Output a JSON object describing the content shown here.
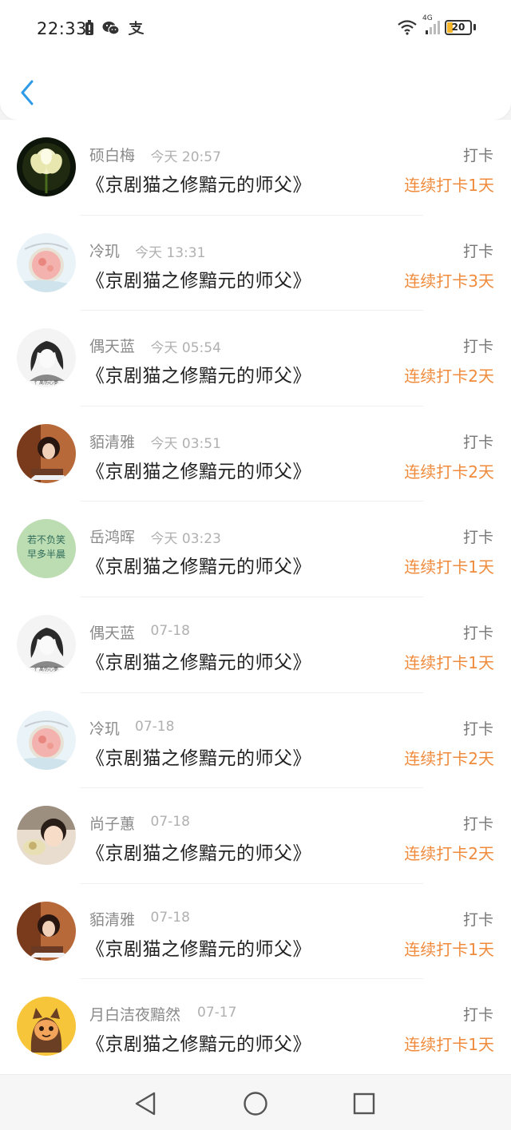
{
  "status_bar": {
    "time": "22:33",
    "battery": "20",
    "network": "4G",
    "left_icons": [
      "battery-saver-icon",
      "wechat-icon",
      "alipay-icon"
    ],
    "right_icons": [
      "wifi-icon",
      "cellular-signal-icon",
      "battery-icon"
    ]
  },
  "header": {
    "back_icon": "chevron-left-icon"
  },
  "colors": {
    "accent": "#f08b3c",
    "back_icon": "#2f9be8",
    "name_text": "#8a8a8a",
    "time_text": "#b0b0b0",
    "title_text": "#222222"
  },
  "checkins": [
    {
      "name": "硕白梅",
      "time": "今天 20:57",
      "title": "《京剧猫之修黯元的师父》",
      "action": "打卡",
      "streak": "连续打卡1天",
      "avatar": "lotus-flower"
    },
    {
      "name": "冷玑",
      "time": "今天 13:31",
      "title": "《京剧猫之修黯元的师父》",
      "action": "打卡",
      "streak": "连续打卡3天",
      "avatar": "pink-pendant"
    },
    {
      "name": "偶天蓝",
      "time": "今天 05:54",
      "title": "《京剧猫之修黯元的师父》",
      "action": "打卡",
      "streak": "连续打卡2天",
      "avatar": "girl-sketch"
    },
    {
      "name": "貊清雅",
      "time": "今天 03:51",
      "title": "《京剧猫之修黯元的师父》",
      "action": "打卡",
      "streak": "连续打卡2天",
      "avatar": "girl-photo"
    },
    {
      "name": "岳鸿晖",
      "time": "今天 03:23",
      "title": "《京剧猫之修黯元的师父》",
      "action": "打卡",
      "streak": "连续打卡1天",
      "avatar": "green-text"
    },
    {
      "name": "偶天蓝",
      "time": "07-18",
      "title": "《京剧猫之修黯元的师父》",
      "action": "打卡",
      "streak": "连续打卡1天",
      "avatar": "girl-sketch"
    },
    {
      "name": "冷玑",
      "time": "07-18",
      "title": "《京剧猫之修黯元的师父》",
      "action": "打卡",
      "streak": "连续打卡2天",
      "avatar": "pink-pendant"
    },
    {
      "name": "尚子蕙",
      "time": "07-18",
      "title": "《京剧猫之修黯元的师父》",
      "action": "打卡",
      "streak": "连续打卡2天",
      "avatar": "child-photo"
    },
    {
      "name": "貊清雅",
      "time": "07-18",
      "title": "《京剧猫之修黯元的师父》",
      "action": "打卡",
      "streak": "连续打卡1天",
      "avatar": "girl-photo"
    },
    {
      "name": "月白洁夜黯然",
      "time": "07-17",
      "title": "《京剧猫之修黯元的师父》",
      "action": "打卡",
      "streak": "连续打卡1天",
      "avatar": "cartoon-cat"
    }
  ],
  "nav_bar": {
    "icons": [
      "back-triangle-icon",
      "home-circle-icon",
      "recents-square-icon"
    ]
  }
}
